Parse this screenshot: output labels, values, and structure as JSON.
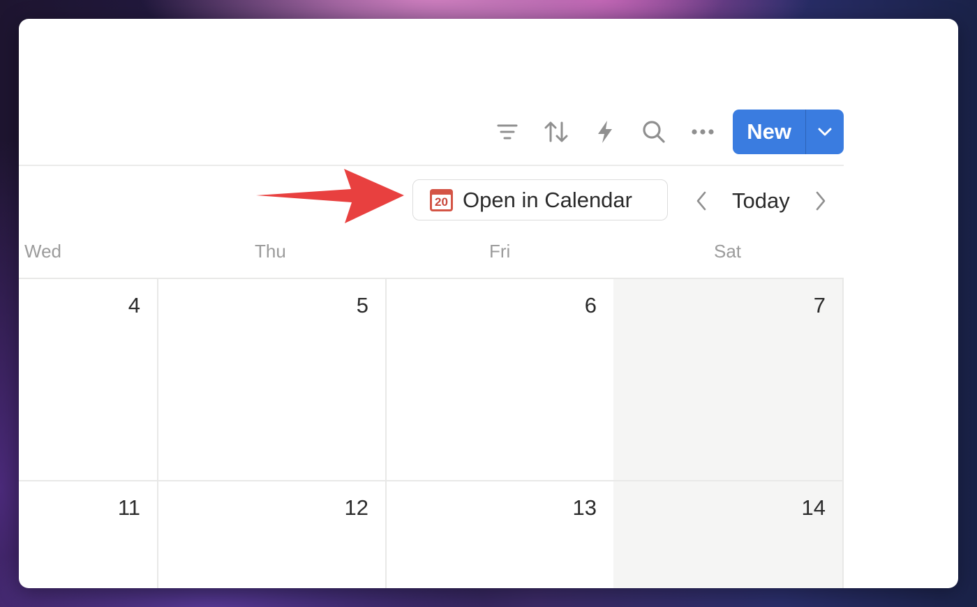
{
  "toolbar": {
    "icons": [
      "filter-icon",
      "sort-icon",
      "automation-icon",
      "search-icon",
      "more-icon"
    ],
    "new_label": "New",
    "new_dropdown_icon": "chevron-down-icon"
  },
  "open_in_calendar": {
    "icon_text": "20",
    "label": "Open in Calendar"
  },
  "navigation": {
    "prev_icon": "chevron-left-icon",
    "today_label": "Today",
    "next_icon": "chevron-right-icon"
  },
  "weekdays": [
    "Wed",
    "Thu",
    "Fri",
    "Sat"
  ],
  "weeks": [
    {
      "days": [
        "4",
        "5",
        "6",
        "7"
      ]
    },
    {
      "days": [
        "11",
        "12",
        "13",
        "14"
      ]
    }
  ],
  "colors": {
    "accent": "#3a7ce0",
    "annotation_arrow": "#e8403f",
    "calendar_icon": "#d45445",
    "weekend_bg": "#f5f5f4"
  }
}
